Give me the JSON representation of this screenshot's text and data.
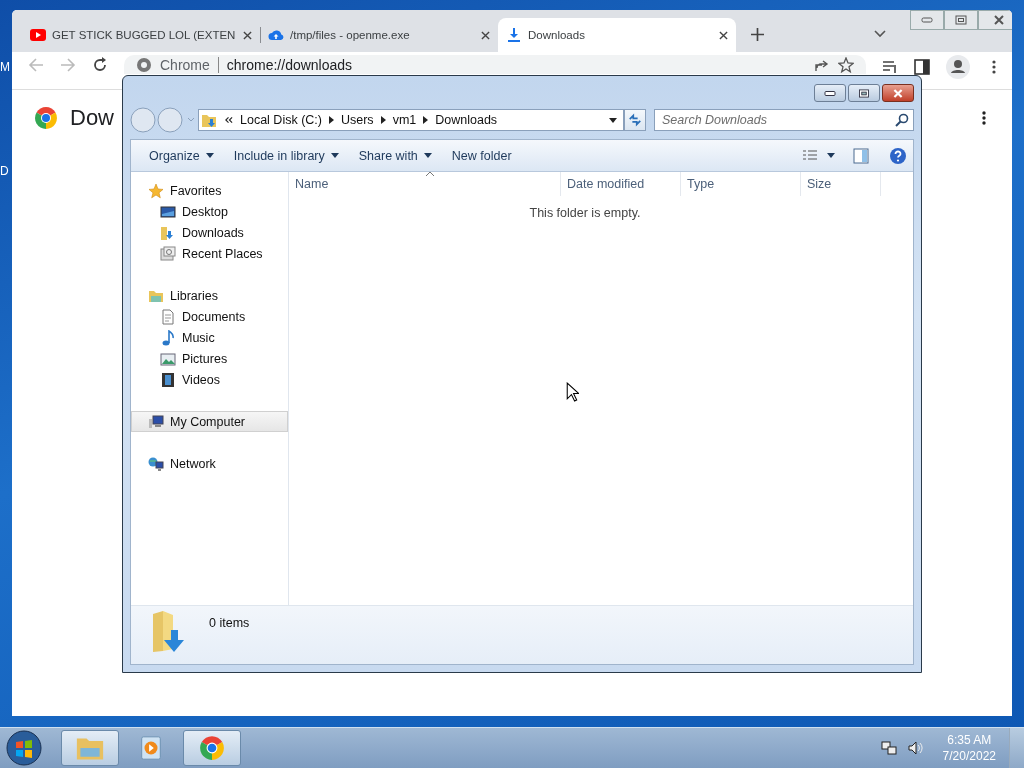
{
  "desktop": {
    "icon_labels": [
      "M",
      "D"
    ]
  },
  "chrome": {
    "tabs": [
      {
        "title": "GET STICK BUGGED LOL (EXTEN",
        "kind": "video",
        "selected": false
      },
      {
        "title": "/tmp/files - openme.exe",
        "kind": "cloud",
        "selected": false
      },
      {
        "title": "Downloads",
        "kind": "download",
        "selected": true
      }
    ],
    "omnibox": {
      "site_label": "Chrome",
      "url": "chrome://downloads"
    },
    "page_title": "Dow"
  },
  "explorer": {
    "breadcrumb": [
      "Local Disk (C:)",
      "Users",
      "vm1",
      "Downloads"
    ],
    "search": {
      "placeholder": "Search Downloads"
    },
    "toolbar": [
      {
        "label": "Organize",
        "dropdown": true
      },
      {
        "label": "Include in library",
        "dropdown": true
      },
      {
        "label": "Share with",
        "dropdown": true
      },
      {
        "label": "New folder",
        "dropdown": false
      }
    ],
    "nav": [
      {
        "label": "Favorites",
        "kind": "star",
        "selected": false,
        "children": [
          {
            "label": "Desktop",
            "kind": "desktop",
            "selected": false
          },
          {
            "label": "Downloads",
            "kind": "download-folder",
            "selected": false
          },
          {
            "label": "Recent Places",
            "kind": "recent",
            "selected": false
          }
        ]
      },
      {
        "label": "Libraries",
        "kind": "library",
        "selected": false,
        "children": [
          {
            "label": "Documents",
            "kind": "document",
            "selected": false
          },
          {
            "label": "Music",
            "kind": "music",
            "selected": false
          },
          {
            "label": "Pictures",
            "kind": "pictures",
            "selected": false
          },
          {
            "label": "Videos",
            "kind": "film",
            "selected": false
          }
        ]
      },
      {
        "label": "My Computer",
        "kind": "computer",
        "selected": true
      },
      {
        "label": "Network",
        "kind": "network",
        "selected": false
      }
    ],
    "columns": [
      "Name",
      "Date modified",
      "Type",
      "Size"
    ],
    "empty_message": "This folder is empty.",
    "status": "0 items"
  },
  "taskbar": {
    "apps": [
      {
        "kind": "folder",
        "open": true
      },
      {
        "kind": "media",
        "open": false
      },
      {
        "kind": "chrome",
        "open": true
      }
    ],
    "time": "6:35 AM",
    "date": "7/20/2022"
  }
}
